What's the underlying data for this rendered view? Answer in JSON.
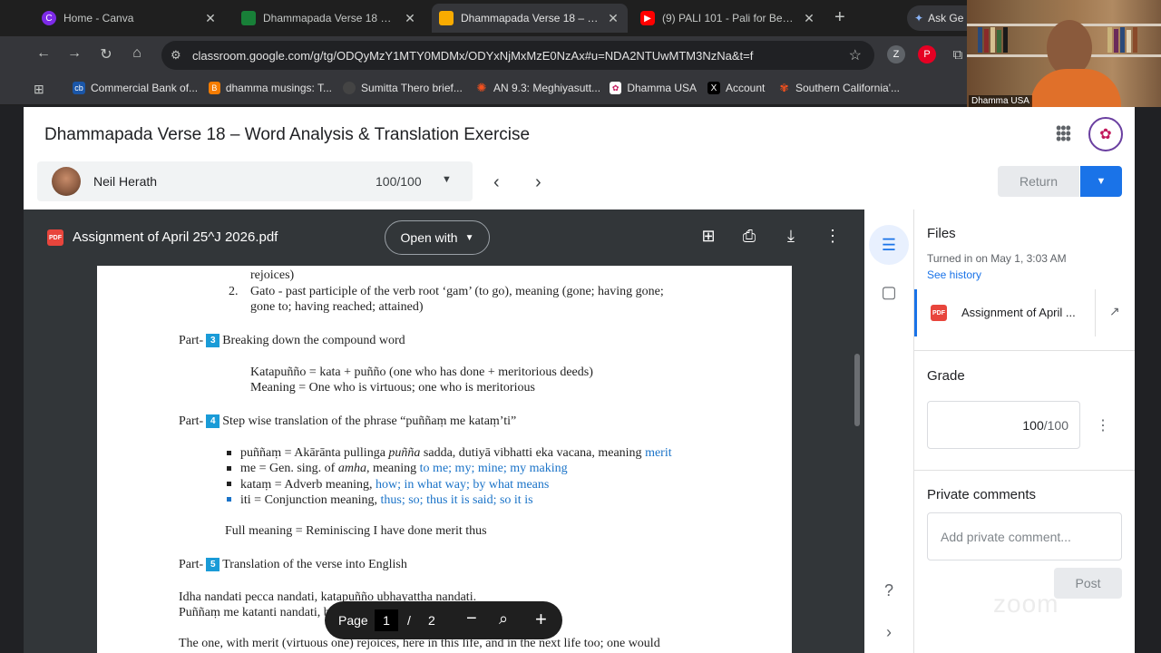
{
  "browser": {
    "tabs": [
      {
        "title": "Home - Canva",
        "icon_color": "#7d2ae8",
        "active": false
      },
      {
        "title": "Dhammapada Verse 18 – Wor",
        "icon_color": "#188038",
        "active": false
      },
      {
        "title": "Dhammapada Verse 18 – Wor",
        "icon_color": "#f9ab00",
        "active": true
      },
      {
        "title": "(9) PALI 101 - Pali for Beginne",
        "icon_color": "#ff0000",
        "active": false
      }
    ],
    "ask_label": "Ask Ge",
    "url": "classroom.google.com/g/tg/ODQyMzY1MTY0MDMx/ODYxNjMxMzE0NzAx#u=NDA2NTUwMTM3NzNa&t=f",
    "bookmarks": [
      {
        "label": "Commercial Bank of...",
        "icon": "cb"
      },
      {
        "label": "dhamma musings: T...",
        "icon": "blogger"
      },
      {
        "label": "Sumitta Thero brief...",
        "icon": "circle"
      },
      {
        "label": "AN 9.3: Meghiyasutt...",
        "icon": "sun"
      },
      {
        "label": "Dhamma USA",
        "icon": "du"
      },
      {
        "label": "Account",
        "icon": "x"
      },
      {
        "label": "Southern California'...",
        "icon": "nbc"
      }
    ]
  },
  "webcam": {
    "name": "Dhamma USA"
  },
  "classroom": {
    "assignment_title": "Dhammapada Verse 18 – Word Analysis & Translation Exercise",
    "student_name": "Neil Herath",
    "student_grade": "100/100",
    "return_label": "Return"
  },
  "viewer": {
    "file_title": "Assignment of April 25^J 2026.pdf",
    "open_with": "Open with",
    "pdf_badge": "PDF",
    "page_label": "Page",
    "page_current": "1",
    "page_sep": "/",
    "page_total": "2"
  },
  "document": {
    "l1": "rejoices)",
    "l2_num": "2.",
    "l2": "Gato - past participle of the verb root ‘gam’ (to go), meaning (gone; having gone;",
    "l3": "gone to; having reached; attained)",
    "part3_pre": "Part-",
    "part3_num": "3",
    "part3": "Breaking down the compound word",
    "k1": "Katapuñño = kata + puñño (one who has done + meritorious deeds)",
    "k2": "Meaning = One who is virtuous; one who is meritorious",
    "part4_pre": "Part-",
    "part4_num": "4",
    "part4": "Step wise translation of the phrase “puññaṃ me kataṃ’ti”",
    "b1a": "puññaṃ = Akārānta pullinga ",
    "b1b": "puñña",
    "b1c": " sadda, dutiyā vibhatti eka vacana, meaning ",
    "b1d": "merit",
    "b2a": "me =  Gen. sing. of ",
    "b2b": "amha",
    "b2c": ", meaning ",
    "b2d": "to me; my; mine; my making",
    "b3a": "kataṃ = Adverb meaning, ",
    "b3b": "how; in what way; by what means",
    "b4a": "iti = Conjunction meaning, ",
    "b4b": "thus; so; thus it is said; so it is",
    "full": "Full meaning = Reminiscing I have done merit thus",
    "part5_pre": "Part-",
    "part5_num": "5",
    "part5": "Translation of the verse into English",
    "v1": "Idha nandati pecca nandati, katapuñño ubhayattha nandati.",
    "v2": "Puññaṃ me katanti nandati, bhiyyo nandati suggatim gato.",
    "v3": "The one, with merit (virtuous one) rejoices, here in this life, and in the next life too; one would"
  },
  "sidepanel": {
    "files_title": "Files",
    "turned_in": "Turned in on May 1, 3:03 AM",
    "see_history": "See history",
    "file_name": "Assignment of April ...",
    "grade_title": "Grade",
    "grade_value": "100",
    "grade_total": "/100",
    "private_title": "Private comments",
    "comment_placeholder": "Add private comment...",
    "post_label": "Post"
  },
  "watermark": "zoom"
}
